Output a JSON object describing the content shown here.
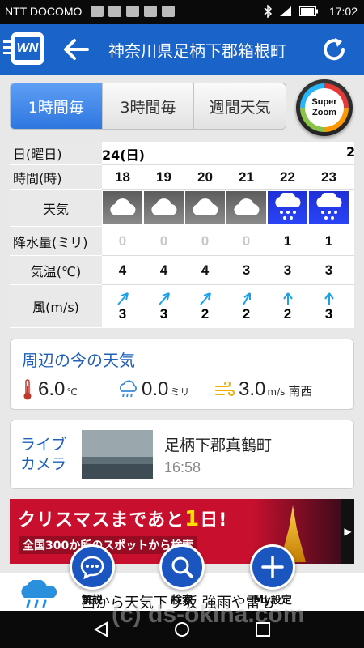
{
  "status": {
    "carrier": "NTT DOCOMO",
    "time": "17:02"
  },
  "header": {
    "title": "神奈川県足柄下郡箱根町",
    "logo": "WN"
  },
  "tabs": [
    "1時間毎",
    "3時間毎",
    "週間天気"
  ],
  "super_zoom": {
    "line1": "Super",
    "line2": "Zoom"
  },
  "forecast": {
    "labels": {
      "date": "日(曜日)",
      "hour": "時間(時)",
      "weather": "天気",
      "precip": "降水量(ミリ)",
      "temp": "気温(℃)",
      "wind": "風(m/s)"
    },
    "date_main": "24(日)",
    "date_next": "2",
    "hours": [
      "18",
      "19",
      "20",
      "21",
      "22",
      "23"
    ],
    "weather": [
      "cloudy",
      "cloudy",
      "cloudy",
      "cloudy",
      "snow",
      "snow"
    ],
    "precip": [
      "0",
      "0",
      "0",
      "0",
      "1",
      "1"
    ],
    "temp": [
      "4",
      "4",
      "4",
      "3",
      "3",
      "3"
    ],
    "wind": [
      "3",
      "3",
      "2",
      "2",
      "2",
      "3"
    ]
  },
  "current": {
    "title": "周辺の今の天気",
    "temp_value": "6.0",
    "temp_unit": "℃",
    "rain_value": "0.0",
    "rain_unit": "ミリ",
    "wind_value": "3.0",
    "wind_unit": "m/s",
    "wind_dir": "南西"
  },
  "live": {
    "title1": "ライブ",
    "title2": "カメラ",
    "place": "足柄下郡真鶴町",
    "time": "16:58"
  },
  "banner": {
    "part1": "クリスマスまであと",
    "num": "1",
    "part2": "日!",
    "sub": "全国300か所のスポットから検索"
  },
  "bottom": {
    "ticker": "西から天気下り坂 強雨や雷も",
    "fab1": "解説",
    "fab2": "検索",
    "fab3": "My設定"
  },
  "watermark": "(c) ds-okina.com",
  "colors": {
    "primary": "#1a63c9",
    "tab_active": "#2f76e0",
    "snow_cell": "#2a44f5"
  }
}
